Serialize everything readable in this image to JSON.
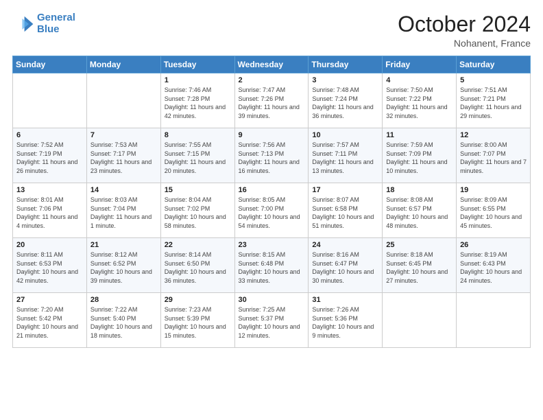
{
  "header": {
    "logo_line1": "General",
    "logo_line2": "Blue",
    "month": "October 2024",
    "location": "Nohanent, France"
  },
  "weekdays": [
    "Sunday",
    "Monday",
    "Tuesday",
    "Wednesday",
    "Thursday",
    "Friday",
    "Saturday"
  ],
  "weeks": [
    [
      {
        "day": "",
        "sunrise": "",
        "sunset": "",
        "daylight": ""
      },
      {
        "day": "",
        "sunrise": "",
        "sunset": "",
        "daylight": ""
      },
      {
        "day": "1",
        "sunrise": "Sunrise: 7:46 AM",
        "sunset": "Sunset: 7:28 PM",
        "daylight": "Daylight: 11 hours and 42 minutes."
      },
      {
        "day": "2",
        "sunrise": "Sunrise: 7:47 AM",
        "sunset": "Sunset: 7:26 PM",
        "daylight": "Daylight: 11 hours and 39 minutes."
      },
      {
        "day": "3",
        "sunrise": "Sunrise: 7:48 AM",
        "sunset": "Sunset: 7:24 PM",
        "daylight": "Daylight: 11 hours and 36 minutes."
      },
      {
        "day": "4",
        "sunrise": "Sunrise: 7:50 AM",
        "sunset": "Sunset: 7:22 PM",
        "daylight": "Daylight: 11 hours and 32 minutes."
      },
      {
        "day": "5",
        "sunrise": "Sunrise: 7:51 AM",
        "sunset": "Sunset: 7:21 PM",
        "daylight": "Daylight: 11 hours and 29 minutes."
      }
    ],
    [
      {
        "day": "6",
        "sunrise": "Sunrise: 7:52 AM",
        "sunset": "Sunset: 7:19 PM",
        "daylight": "Daylight: 11 hours and 26 minutes."
      },
      {
        "day": "7",
        "sunrise": "Sunrise: 7:53 AM",
        "sunset": "Sunset: 7:17 PM",
        "daylight": "Daylight: 11 hours and 23 minutes."
      },
      {
        "day": "8",
        "sunrise": "Sunrise: 7:55 AM",
        "sunset": "Sunset: 7:15 PM",
        "daylight": "Daylight: 11 hours and 20 minutes."
      },
      {
        "day": "9",
        "sunrise": "Sunrise: 7:56 AM",
        "sunset": "Sunset: 7:13 PM",
        "daylight": "Daylight: 11 hours and 16 minutes."
      },
      {
        "day": "10",
        "sunrise": "Sunrise: 7:57 AM",
        "sunset": "Sunset: 7:11 PM",
        "daylight": "Daylight: 11 hours and 13 minutes."
      },
      {
        "day": "11",
        "sunrise": "Sunrise: 7:59 AM",
        "sunset": "Sunset: 7:09 PM",
        "daylight": "Daylight: 11 hours and 10 minutes."
      },
      {
        "day": "12",
        "sunrise": "Sunrise: 8:00 AM",
        "sunset": "Sunset: 7:07 PM",
        "daylight": "Daylight: 11 hours and 7 minutes."
      }
    ],
    [
      {
        "day": "13",
        "sunrise": "Sunrise: 8:01 AM",
        "sunset": "Sunset: 7:06 PM",
        "daylight": "Daylight: 11 hours and 4 minutes."
      },
      {
        "day": "14",
        "sunrise": "Sunrise: 8:03 AM",
        "sunset": "Sunset: 7:04 PM",
        "daylight": "Daylight: 11 hours and 1 minute."
      },
      {
        "day": "15",
        "sunrise": "Sunrise: 8:04 AM",
        "sunset": "Sunset: 7:02 PM",
        "daylight": "Daylight: 10 hours and 58 minutes."
      },
      {
        "day": "16",
        "sunrise": "Sunrise: 8:05 AM",
        "sunset": "Sunset: 7:00 PM",
        "daylight": "Daylight: 10 hours and 54 minutes."
      },
      {
        "day": "17",
        "sunrise": "Sunrise: 8:07 AM",
        "sunset": "Sunset: 6:58 PM",
        "daylight": "Daylight: 10 hours and 51 minutes."
      },
      {
        "day": "18",
        "sunrise": "Sunrise: 8:08 AM",
        "sunset": "Sunset: 6:57 PM",
        "daylight": "Daylight: 10 hours and 48 minutes."
      },
      {
        "day": "19",
        "sunrise": "Sunrise: 8:09 AM",
        "sunset": "Sunset: 6:55 PM",
        "daylight": "Daylight: 10 hours and 45 minutes."
      }
    ],
    [
      {
        "day": "20",
        "sunrise": "Sunrise: 8:11 AM",
        "sunset": "Sunset: 6:53 PM",
        "daylight": "Daylight: 10 hours and 42 minutes."
      },
      {
        "day": "21",
        "sunrise": "Sunrise: 8:12 AM",
        "sunset": "Sunset: 6:52 PM",
        "daylight": "Daylight: 10 hours and 39 minutes."
      },
      {
        "day": "22",
        "sunrise": "Sunrise: 8:14 AM",
        "sunset": "Sunset: 6:50 PM",
        "daylight": "Daylight: 10 hours and 36 minutes."
      },
      {
        "day": "23",
        "sunrise": "Sunrise: 8:15 AM",
        "sunset": "Sunset: 6:48 PM",
        "daylight": "Daylight: 10 hours and 33 minutes."
      },
      {
        "day": "24",
        "sunrise": "Sunrise: 8:16 AM",
        "sunset": "Sunset: 6:47 PM",
        "daylight": "Daylight: 10 hours and 30 minutes."
      },
      {
        "day": "25",
        "sunrise": "Sunrise: 8:18 AM",
        "sunset": "Sunset: 6:45 PM",
        "daylight": "Daylight: 10 hours and 27 minutes."
      },
      {
        "day": "26",
        "sunrise": "Sunrise: 8:19 AM",
        "sunset": "Sunset: 6:43 PM",
        "daylight": "Daylight: 10 hours and 24 minutes."
      }
    ],
    [
      {
        "day": "27",
        "sunrise": "Sunrise: 7:20 AM",
        "sunset": "Sunset: 5:42 PM",
        "daylight": "Daylight: 10 hours and 21 minutes."
      },
      {
        "day": "28",
        "sunrise": "Sunrise: 7:22 AM",
        "sunset": "Sunset: 5:40 PM",
        "daylight": "Daylight: 10 hours and 18 minutes."
      },
      {
        "day": "29",
        "sunrise": "Sunrise: 7:23 AM",
        "sunset": "Sunset: 5:39 PM",
        "daylight": "Daylight: 10 hours and 15 minutes."
      },
      {
        "day": "30",
        "sunrise": "Sunrise: 7:25 AM",
        "sunset": "Sunset: 5:37 PM",
        "daylight": "Daylight: 10 hours and 12 minutes."
      },
      {
        "day": "31",
        "sunrise": "Sunrise: 7:26 AM",
        "sunset": "Sunset: 5:36 PM",
        "daylight": "Daylight: 10 hours and 9 minutes."
      },
      {
        "day": "",
        "sunrise": "",
        "sunset": "",
        "daylight": ""
      },
      {
        "day": "",
        "sunrise": "",
        "sunset": "",
        "daylight": ""
      }
    ]
  ]
}
